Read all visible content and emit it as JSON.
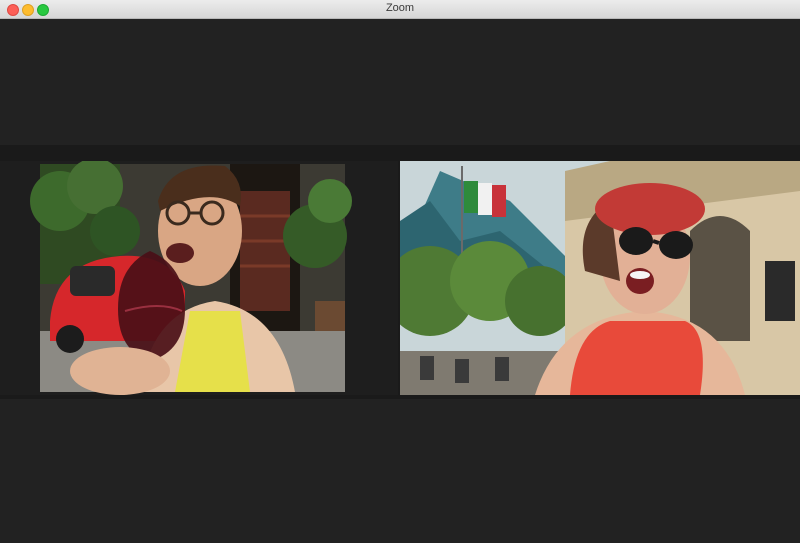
{
  "window": {
    "title": "Zoom",
    "controls": [
      "close",
      "minimize",
      "zoom"
    ]
  },
  "participants": [
    {
      "tile": "participant-1",
      "active_speaker": true
    },
    {
      "tile": "participant-2",
      "active_speaker": false
    }
  ],
  "colors": {
    "active_speaker_border": "#c5e05a",
    "background": "#1a1a1a"
  }
}
